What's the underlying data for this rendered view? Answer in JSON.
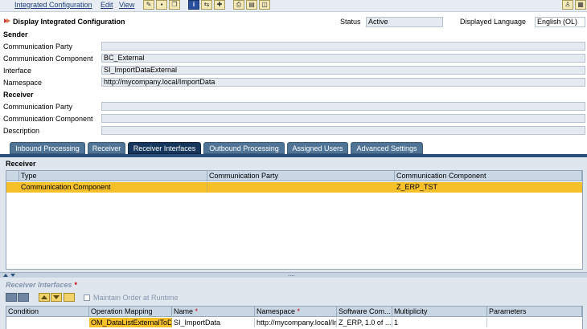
{
  "menubar": {
    "items": [
      "Integrated Configuration",
      "Edit",
      "View"
    ]
  },
  "header": {
    "title": "Display Integrated Configuration",
    "status_label": "Status",
    "status_value": "Active",
    "language_label": "Displayed Language",
    "language_value": "English (OL)"
  },
  "sender": {
    "section": "Sender",
    "party_label": "Communication Party",
    "party_value": "",
    "component_label": "Communication Component",
    "component_value": "BC_External",
    "interface_label": "Interface",
    "interface_value": "SI_ImportDataExternal",
    "namespace_label": "Namespace",
    "namespace_value": "http://mycompany.local/ImportData"
  },
  "receiver": {
    "section": "Receiver",
    "party_label": "Communication Party",
    "party_value": "",
    "component_label": "Communication Component",
    "component_value": "",
    "description_label": "Description",
    "description_value": ""
  },
  "tabs": [
    "Inbound Processing",
    "Receiver",
    "Receiver Interfaces",
    "Outbound Processing",
    "Assigned Users",
    "Advanced Settings"
  ],
  "active_tab": "Receiver Interfaces",
  "receiver_table": {
    "title": "Receiver",
    "headers": [
      "Type",
      "Communication Party",
      "Communication Component"
    ],
    "rows": [
      {
        "type": "Communication Component",
        "party": "",
        "component": "Z_ERP_TST"
      }
    ]
  },
  "receiver_interfaces": {
    "title": "Receiver Interfaces",
    "required_marker": "*",
    "maintain_order_label": "Maintain Order at Runtime",
    "headers": [
      "Condition",
      "Operation Mapping",
      "Name",
      "Namespace",
      "Software Com...",
      "Multiplicity",
      "Parameters"
    ],
    "name_required": "*",
    "namespace_required": "*",
    "rows": [
      {
        "condition": "",
        "operation_mapping": "OM_DataListExternalToDataL",
        "name": "SI_ImportData",
        "namespace": "http://mycompany.local/ImportData",
        "software_component": "Z_ERP, 1.0 of ...",
        "multiplicity": "1"
      }
    ]
  },
  "colors": {
    "tab_active": "#16365b",
    "tab_inactive": "#4f7496",
    "row_selected": "#f6c02b"
  }
}
